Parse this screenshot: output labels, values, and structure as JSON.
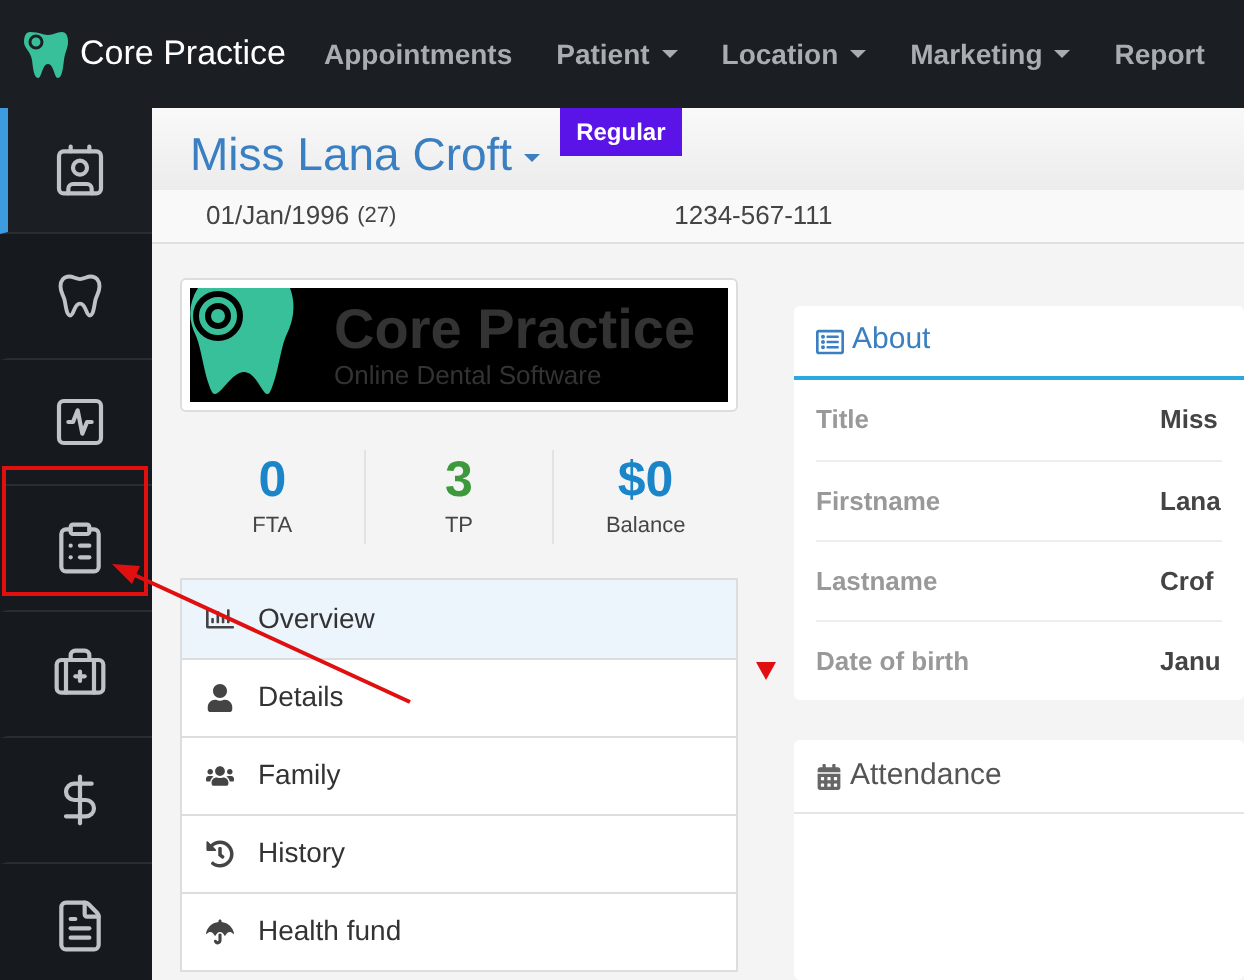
{
  "brand": "Core Practice",
  "nav": [
    {
      "label": "Appointments",
      "dropdown": false
    },
    {
      "label": "Patient",
      "dropdown": true
    },
    {
      "label": "Location",
      "dropdown": true
    },
    {
      "label": "Marketing",
      "dropdown": true
    },
    {
      "label": "Report",
      "dropdown": false
    }
  ],
  "sidebar": [
    {
      "kind": "id-card",
      "selected": true
    },
    {
      "kind": "tooth",
      "selected": false
    },
    {
      "kind": "activity",
      "selected": false
    },
    {
      "kind": "clipboard",
      "selected": false
    },
    {
      "kind": "medkit",
      "selected": false
    },
    {
      "kind": "dollar",
      "selected": false
    },
    {
      "kind": "invoice",
      "selected": false
    }
  ],
  "patient": {
    "name": "Miss Lana Croft",
    "badge": "Regular"
  },
  "info": {
    "dob": "01/Jan/1996",
    "age": "(27)",
    "mobile": "1234-567-111"
  },
  "logo": {
    "title": "Core Practice",
    "subtitle": "Online Dental Software"
  },
  "stats": [
    {
      "value": "0",
      "label": "FTA",
      "color": "#1a86c9"
    },
    {
      "value": "3",
      "label": "TP",
      "color": "#3c9a3c"
    },
    {
      "value": "$0",
      "label": "Balance",
      "color": "#1a86c9"
    }
  ],
  "menu": [
    {
      "label": "Overview",
      "kind": "chart",
      "selected": true
    },
    {
      "label": "Details",
      "kind": "user",
      "selected": false
    },
    {
      "label": "Family",
      "kind": "users",
      "selected": false
    },
    {
      "label": "History",
      "kind": "history",
      "selected": false
    },
    {
      "label": "Health fund",
      "kind": "umbrella",
      "selected": false
    }
  ],
  "about": {
    "title": "About",
    "rows": [
      {
        "label": "Title",
        "value": "Miss"
      },
      {
        "label": "Firstname",
        "value": "Lana"
      },
      {
        "label": "Lastname",
        "value": "Crof"
      },
      {
        "label": "Date of birth",
        "value": "Janu"
      }
    ]
  },
  "attendance": {
    "title": "Attendance"
  }
}
